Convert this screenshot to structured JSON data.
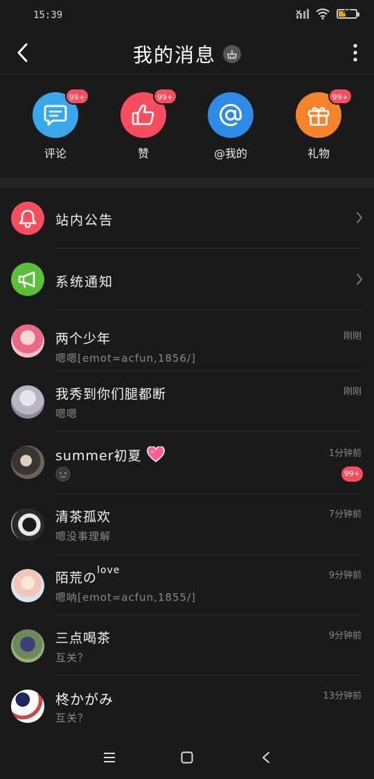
{
  "status": {
    "time": "15:39",
    "battery": "40",
    "battery_level": 0.4
  },
  "header": {
    "title": "我的消息"
  },
  "quick": [
    {
      "label": "评论",
      "badge": "99+",
      "color": "#3aa7ec",
      "icon": "comment-icon"
    },
    {
      "label": "赞",
      "badge": "99+",
      "color": "#f84d5e",
      "icon": "thumbs-up-icon"
    },
    {
      "label": "@我的",
      "badge": "",
      "color": "#2f8be8",
      "icon": "at-icon"
    },
    {
      "label": "礼物",
      "badge": "99+",
      "color": "#f5832b",
      "icon": "gift-icon"
    }
  ],
  "system_rows": [
    {
      "title": "站内公告",
      "color": "#f84d5e",
      "icon": "bell-icon"
    },
    {
      "title": "系统通知",
      "color": "#5bbf3a",
      "icon": "megaphone-icon"
    }
  ],
  "messages": [
    {
      "name": "两个少年",
      "preview": "嗯嗯[emot=acfun,1856/]",
      "time": "刚刚",
      "unread": ""
    },
    {
      "name": "我秀到你们腿都断",
      "preview": "嗯嗯",
      "time": "刚刚",
      "unread": ""
    },
    {
      "name": "summer初夏",
      "preview": "",
      "time": "1分钟前",
      "unread": "99+"
    },
    {
      "name": "清茶孤欢",
      "preview": "嗯没事理解",
      "time": "7分钟前",
      "unread": ""
    },
    {
      "name": "陌荒の",
      "name_sup": "love",
      "preview": "嗯呐[emot=acfun,1855/]",
      "time": "9分钟前",
      "unread": ""
    },
    {
      "name": "三点喝茶",
      "preview": "互关？",
      "time": "9分钟前",
      "unread": ""
    },
    {
      "name": "柊かがみ",
      "preview": "互关？",
      "time": "13分钟前",
      "unread": ""
    }
  ]
}
